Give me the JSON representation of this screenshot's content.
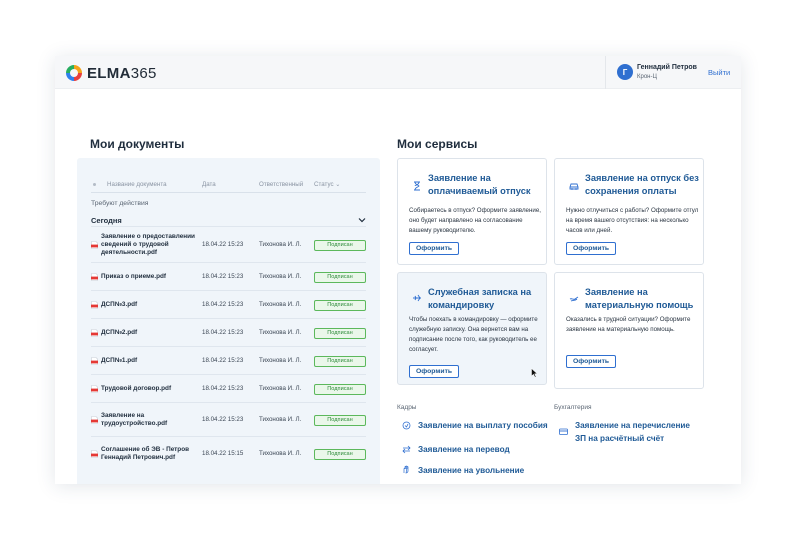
{
  "header": {
    "logo_text": "ELMA",
    "logo_num": "365",
    "user_initial": "Г",
    "user_name": "Геннадий  Петров",
    "user_org": "Крон-Ц",
    "logout": "Выйти"
  },
  "documents": {
    "title": "Мои документы",
    "columns": [
      "Название документа",
      "Дата",
      "Ответственный",
      "Статус"
    ],
    "status_sort_mark": "⌄",
    "action_required": "Требуют действия",
    "today": "Сегодня",
    "rows": [
      {
        "name": "Заявление о предоставлении сведений о трудовой деятельности.pdf",
        "date": "18.04.22 15:23",
        "responsible": "Тихонова И. Л.",
        "status": "Подписан"
      },
      {
        "name": "Приказ о приеме.pdf",
        "date": "18.04.22 15:23",
        "responsible": "Тихонова И. Л.",
        "status": "Подписан"
      },
      {
        "name": "ДСП№3.pdf",
        "date": "18.04.22 15:23",
        "responsible": "Тихонова И. Л.",
        "status": "Подписан"
      },
      {
        "name": "ДСП№2.pdf",
        "date": "18.04.22 15:23",
        "responsible": "Тихонова И. Л.",
        "status": "Подписан"
      },
      {
        "name": "ДСП№1.pdf",
        "date": "18.04.22 15:23",
        "responsible": "Тихонова И. Л.",
        "status": "Подписан"
      },
      {
        "name": "Трудовой договор.pdf",
        "date": "18.04.22 15:23",
        "responsible": "Тихонова И. Л.",
        "status": "Подписан"
      },
      {
        "name": "Заявление на трудоустройство.pdf",
        "date": "18.04.22 15:23",
        "responsible": "Тихонова И. Л.",
        "status": "Подписан"
      },
      {
        "name": "Соглашение об ЭВ - Петров Геннадий Петрович.pdf",
        "date": "18.04.22 15:15",
        "responsible": "Тихонова И. Л.",
        "status": "Подписан"
      }
    ]
  },
  "services": {
    "title": "Мои сервисы",
    "cards": [
      {
        "title": "Заявление на оплачиваемый отпуск",
        "desc": "Собираетесь в отпуск? Оформите заявление, оно будет направлено на согласование вашему руководителю.",
        "button": "Оформить",
        "icon": "hourglass-icon"
      },
      {
        "title": "Заявление на отпуск без сохранения оплаты",
        "desc": "Нужно отлучиться с работы? Оформите отгул на время вашего отсутствия: на несколько часов или дней.",
        "button": "Оформить",
        "icon": "car-icon"
      },
      {
        "title": "Служебная записка на командировку",
        "desc": "Чтобы поехать в командировку — оформите служебную записку. Она вернется вам на подписание после того, как руководитель ее согласует.",
        "button": "Оформить",
        "icon": "plane-icon"
      },
      {
        "title": "Заявление на материальную помощь",
        "desc": "Оказались в трудной ситуации? Оформите заявление на материальную помощь.",
        "button": "Оформить",
        "icon": "hands-icon"
      }
    ],
    "groups": [
      {
        "label": "Кадры",
        "links": [
          "Заявление на выплату пособия",
          "Заявление на перевод",
          "Заявление на увольнение"
        ]
      },
      {
        "label": "Бухгалтерия",
        "links": [
          "Заявление на перечисление ЗП на расчётный счёт"
        ]
      }
    ]
  },
  "colors": {
    "accent": "#1f5a96",
    "status_green": "#5cb85c",
    "panel_bg": "#f0f5fa"
  }
}
